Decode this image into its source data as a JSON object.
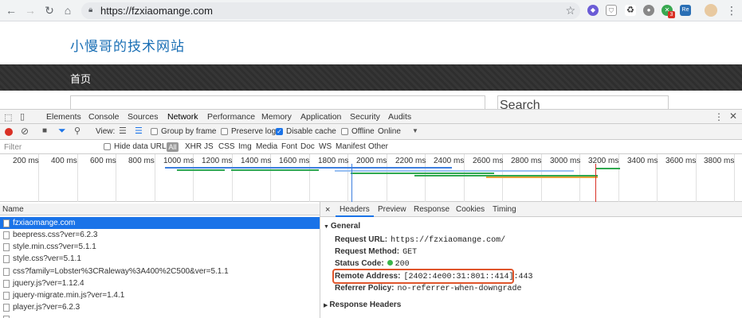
{
  "browser": {
    "url": "https://fzxiaomange.com",
    "ext_badge": "3"
  },
  "page": {
    "site_title": "小慢哥的技术网站",
    "nav_home": "首页",
    "search_placeholder": "Search"
  },
  "devtools": {
    "tabs": [
      "Elements",
      "Console",
      "Sources",
      "Network",
      "Performance",
      "Memory",
      "Application",
      "Security",
      "Audits"
    ],
    "active_tab": "Network",
    "toolbar": {
      "view_label": "View:",
      "group_by_frame": "Group by frame",
      "preserve_log": "Preserve log",
      "disable_cache": "Disable cache",
      "offline": "Offline",
      "throttle": "Online"
    },
    "filter": {
      "placeholder": "Filter",
      "hide_data_urls": "Hide data URLs",
      "types": [
        "All",
        "XHR",
        "JS",
        "CSS",
        "Img",
        "Media",
        "Font",
        "Doc",
        "WS",
        "Manifest",
        "Other"
      ]
    },
    "timeline_ticks": [
      "200 ms",
      "400 ms",
      "600 ms",
      "800 ms",
      "1000 ms",
      "1200 ms",
      "1400 ms",
      "1600 ms",
      "1800 ms",
      "2000 ms",
      "2200 ms",
      "2400 ms",
      "2600 ms",
      "2800 ms",
      "3000 ms",
      "3200 ms",
      "3400 ms",
      "3600 ms",
      "3800 ms"
    ],
    "list_header": "Name",
    "requests": [
      "fzxiaomange.com",
      "beepress.css?ver=6.2.3",
      "style.min.css?ver=5.1.1",
      "style.css?ver=5.1.1",
      "css?family=Lobster%3CRaleway%3A400%2C500&ver=5.1.1",
      "jquery.js?ver=1.12.4",
      "jquery-migrate.min.js?ver=1.4.1",
      "player.js?ver=6.2.3"
    ],
    "detail": {
      "close": "×",
      "tabs": [
        "Headers",
        "Preview",
        "Response",
        "Cookies",
        "Timing"
      ],
      "general_title": "General",
      "request_url_k": "Request URL:",
      "request_url_v": "https://fzxiaomange.com/",
      "request_method_k": "Request Method:",
      "request_method_v": "GET",
      "status_code_k": "Status Code:",
      "status_code_v": "200",
      "remote_address_k": "Remote Address:",
      "remote_address_v": "[2402:4e00:31:801::414]:443",
      "referrer_policy_k": "Referrer Policy:",
      "referrer_policy_v": "no-referrer-when-downgrade",
      "response_headers_title": "Response Headers"
    }
  }
}
